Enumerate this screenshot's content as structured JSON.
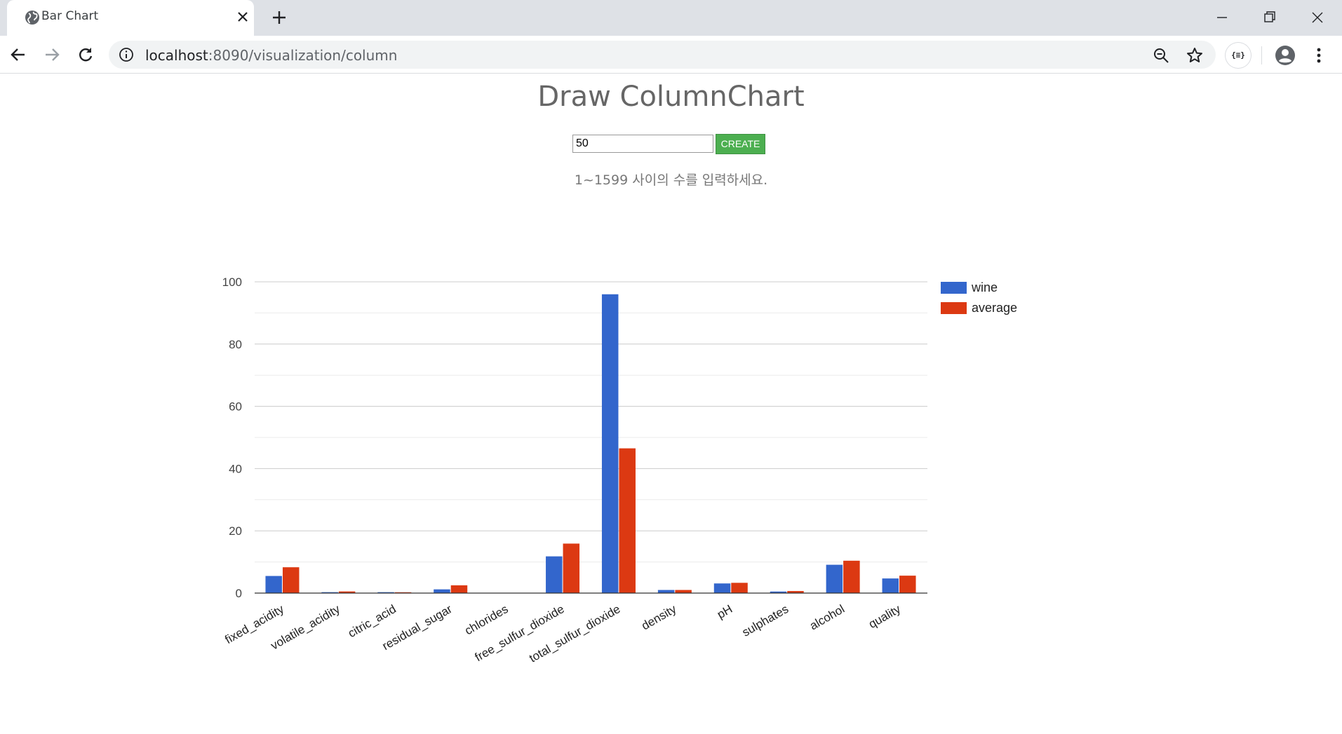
{
  "browser": {
    "tab_title": "Bar Chart",
    "url_host": "localhost",
    "url_rest": ":8090/visualization/column",
    "extension_label": "{≡}"
  },
  "page": {
    "title": "Draw ColumnChart",
    "input_value": "50",
    "create_label": "CREATE",
    "hint": "1~1599 사이의 수를 입력하세요."
  },
  "chart_data": {
    "type": "bar",
    "title": "",
    "xlabel": "",
    "ylabel": "",
    "ylim": [
      0,
      100
    ],
    "yticks": [
      0,
      20,
      40,
      60,
      80,
      100
    ],
    "grid": true,
    "legend_position": "right",
    "categories": [
      "fixed_acidity",
      "volatile_acidity",
      "citric_acid",
      "residual_sugar",
      "chlorides",
      "free_sulfur_dioxide",
      "total_sulfur_dioxide",
      "density",
      "pH",
      "sulphates",
      "alcohol",
      "quality"
    ],
    "series": [
      {
        "name": "wine",
        "color": "#3366cc",
        "values": [
          5.5,
          0.3,
          0.3,
          1.2,
          0.08,
          11.8,
          96,
          1.0,
          3.1,
          0.5,
          9.1,
          4.7
        ]
      },
      {
        "name": "average",
        "color": "#dc3912",
        "values": [
          8.3,
          0.53,
          0.27,
          2.5,
          0.09,
          15.9,
          46.5,
          1.0,
          3.3,
          0.66,
          10.4,
          5.6
        ]
      }
    ]
  }
}
